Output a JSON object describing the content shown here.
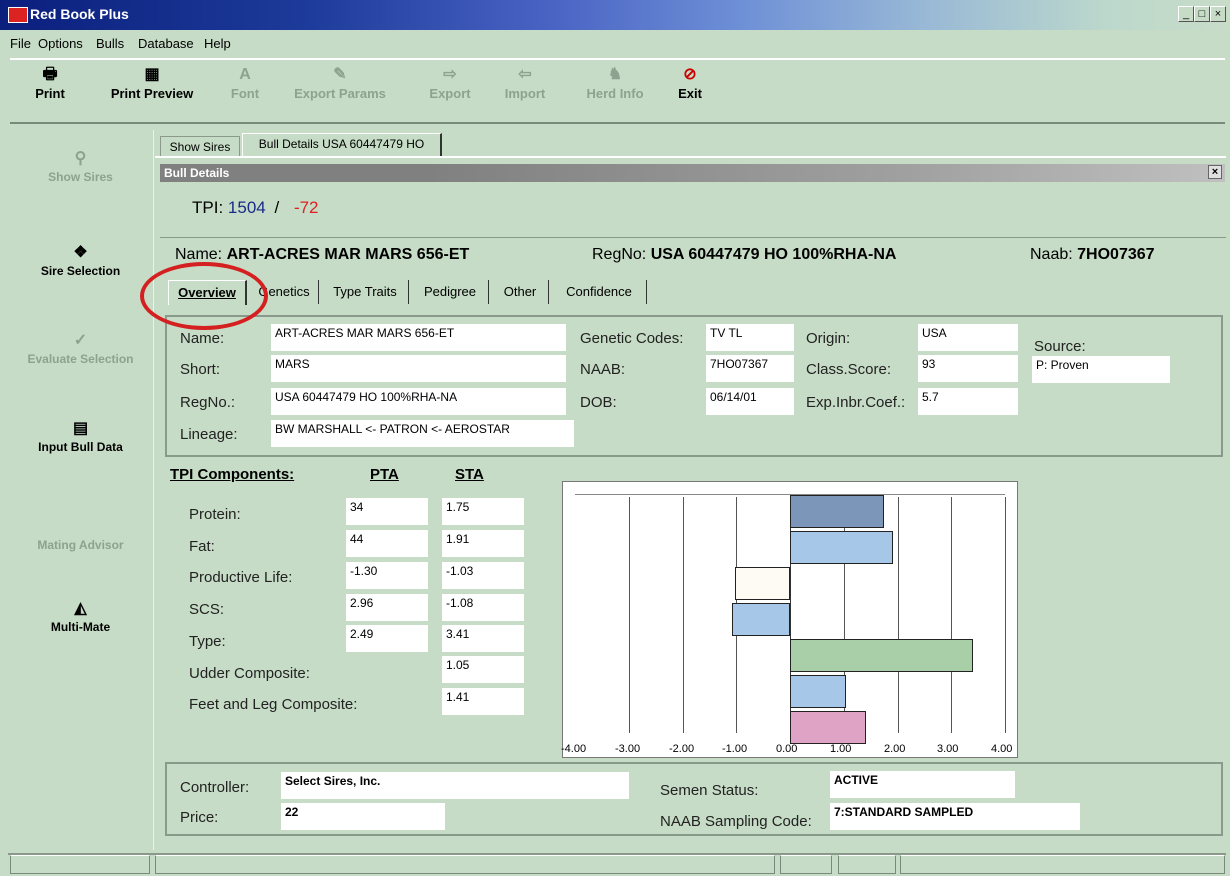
{
  "window": {
    "title": "Red Book Plus"
  },
  "menu": [
    "File",
    "Options",
    "Bulls",
    "Database",
    "Help"
  ],
  "toolbar": [
    {
      "label": "Print",
      "enabled": true
    },
    {
      "label": "Print Preview",
      "enabled": true
    },
    {
      "label": "Font",
      "enabled": false
    },
    {
      "label": "Export Params",
      "enabled": false
    },
    {
      "label": "Export",
      "enabled": false
    },
    {
      "label": "Import",
      "enabled": false
    },
    {
      "label": "Herd Info",
      "enabled": false
    },
    {
      "label": "Exit",
      "enabled": true
    }
  ],
  "sidebar": [
    {
      "label": "Show Sires",
      "enabled": false
    },
    {
      "label": "Sire Selection",
      "enabled": true
    },
    {
      "label": "Evaluate Selection",
      "enabled": false
    },
    {
      "label": "Input Bull Data",
      "enabled": true
    },
    {
      "label": "Mating Advisor",
      "enabled": false
    },
    {
      "label": "Multi-Mate",
      "enabled": true
    }
  ],
  "tabs": [
    "Show Sires",
    "Bull Details  USA 60447479 HO"
  ],
  "panel_title": "Bull Details",
  "tpi": {
    "label": "TPI:",
    "value": "1504",
    "sep": "/",
    "change": "-72"
  },
  "header": {
    "name_label": "Name:",
    "name": "ART-ACRES MAR MARS 656-ET",
    "regno_label": "RegNo:",
    "regno": "USA 60447479 HO 100%RHA-NA",
    "naab_label": "Naab:",
    "naab": "7HO07367"
  },
  "subtabs": [
    "Overview",
    "Genetics",
    "Type Traits",
    "Pedigree",
    "Other",
    "Confidence"
  ],
  "overview": {
    "name_label": "Name:",
    "name": "ART-ACRES MAR MARS 656-ET",
    "short_label": "Short:",
    "short": "MARS",
    "regno_label": "RegNo.:",
    "regno": "USA 60447479 HO 100%RHA-NA",
    "lineage_label": "Lineage:",
    "lineage": "BW MARSHALL <- PATRON <- AEROSTAR",
    "genetic_codes_label": "Genetic Codes:",
    "genetic_codes": "TV TL",
    "naab_label": "NAAB:",
    "naab": "7HO07367",
    "dob_label": "DOB:",
    "dob": "06/14/01",
    "origin_label": "Origin:",
    "origin": "USA",
    "class_score_label": "Class.Score:",
    "class_score": "93",
    "inbr_label": "Exp.Inbr.Coef.:",
    "inbr": "5.7",
    "source_label": "Source:",
    "source": "P: Proven"
  },
  "components": {
    "title": "TPI Components:",
    "pta_header": "PTA",
    "sta_header": "STA",
    "rows": [
      {
        "label": "Protein:",
        "pta": "34",
        "sta": "1.75"
      },
      {
        "label": "Fat:",
        "pta": "44",
        "sta": "1.91"
      },
      {
        "label": "Productive Life:",
        "pta": "-1.30",
        "sta": "-1.03"
      },
      {
        "label": "SCS:",
        "pta": "2.96",
        "sta": "-1.08"
      },
      {
        "label": "Type:",
        "pta": "2.49",
        "sta": "3.41"
      },
      {
        "label": "Udder Composite:",
        "pta": "",
        "sta": "1.05"
      },
      {
        "label": "Feet and Leg Composite:",
        "pta": "",
        "sta": "1.41"
      }
    ]
  },
  "chart_data": {
    "type": "bar",
    "orientation": "horizontal",
    "categories": [
      "Protein",
      "Fat",
      "Productive Life",
      "SCS",
      "Type",
      "Udder Composite",
      "Feet and Leg Composite"
    ],
    "values": [
      1.75,
      1.91,
      -1.03,
      -1.08,
      3.41,
      1.05,
      1.41
    ],
    "colors": [
      "#7b96b8",
      "#a7c7e8",
      "#fdfbf4",
      "#a7c7e8",
      "#a9cfa9",
      "#a7c7e8",
      "#dfa3c6"
    ],
    "xlim": [
      -4,
      4
    ],
    "ticks": [
      "-4.00",
      "-3.00",
      "-2.00",
      "-1.00",
      "0.00",
      "1.00",
      "2.00",
      "3.00",
      "4.00"
    ],
    "grid": true
  },
  "footer": {
    "controller_label": "Controller:",
    "controller": "Select Sires, Inc.",
    "price_label": "Price:",
    "price": "22",
    "semen_label": "Semen Status:",
    "semen": "ACTIVE",
    "sampling_label": "NAAB Sampling Code:",
    "sampling": "7:STANDARD SAMPLED"
  }
}
